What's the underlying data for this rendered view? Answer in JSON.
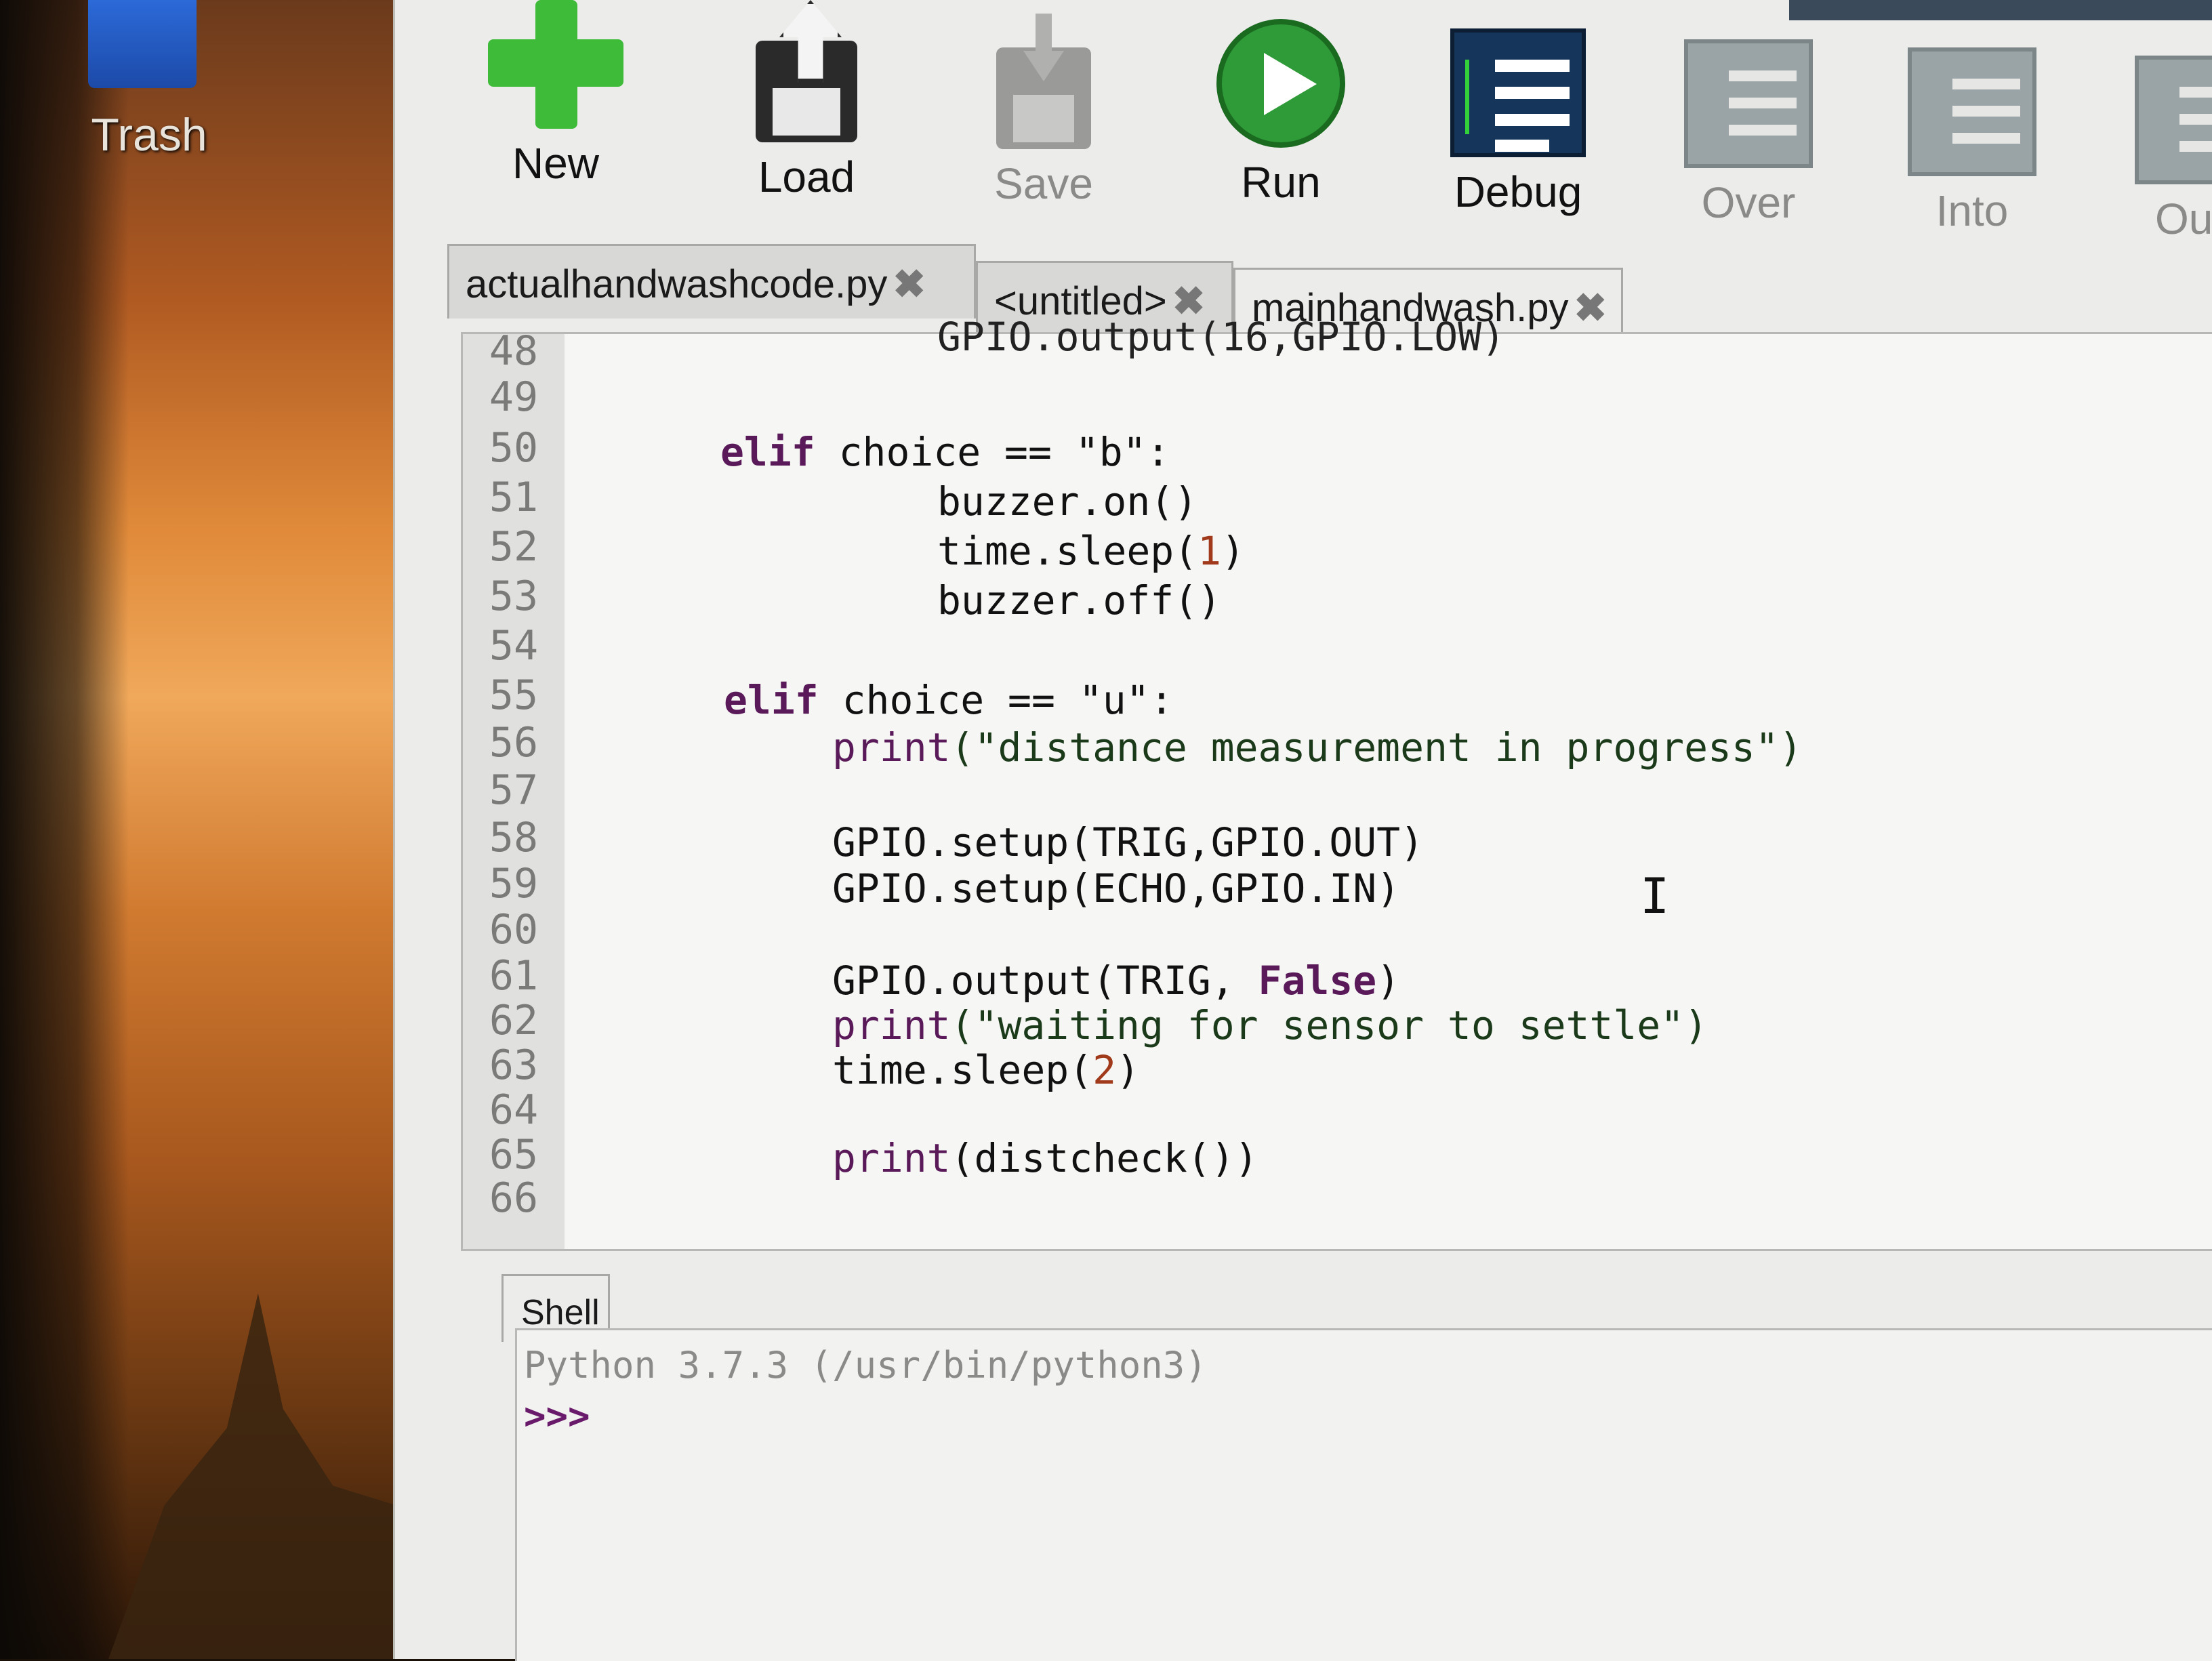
{
  "desktop": {
    "trash_label": "Trash"
  },
  "toolbar": {
    "new_label": "New",
    "load_label": "Load",
    "save_label": "Save",
    "run_label": "Run",
    "debug_label": "Debug",
    "over_label": "Over",
    "into_label": "Into",
    "out_label": "Out"
  },
  "tabs": [
    {
      "label": "actualhandwashcode.py",
      "close": "✖"
    },
    {
      "label": "<untitled>",
      "close": "✖"
    },
    {
      "label": "mainhandwash.py",
      "close": "✖"
    }
  ],
  "editor": {
    "line_numbers": [
      "48",
      "49",
      "50",
      "51",
      "52",
      "53",
      "54",
      "55",
      "56",
      "57",
      "58",
      "59",
      "60",
      "61",
      "62",
      "63",
      "64",
      "65",
      "66"
    ],
    "first_line_partial": "GPIO.output(16,GPIO.LOW)",
    "lines": {
      "l50_kw": "elif",
      "l50_rest": " choice == \"b\":",
      "l51": "buzzer.on()",
      "l52_a": "time.sleep(",
      "l52_num": "1",
      "l52_b": ")",
      "l53": "buzzer.off()",
      "l55_kw": "elif",
      "l55_rest": " choice == \"u\":",
      "l56_fn": "print",
      "l56_str": "(\"distance measurement in progress\")",
      "l58": "GPIO.setup(TRIG,GPIO.OUT)",
      "l59": "GPIO.setup(ECHO,GPIO.IN)",
      "l61_a": "GPIO.output(TRIG, ",
      "l61_kw": "False",
      "l61_b": ")",
      "l62_fn": "print",
      "l62_str": "(\"waiting for sensor to settle\")",
      "l63_a": "time.sleep(",
      "l63_num": "2",
      "l63_b": ")",
      "l65_fn": "print",
      "l65_rest": "(distcheck())"
    }
  },
  "shell": {
    "tab_label": "Shell",
    "banner": "Python 3.7.3 (/usr/bin/python3)",
    "prompt": ">>>"
  },
  "colors": {
    "keyword": "#5a1a5a",
    "number": "#a03a1a",
    "run_green": "#2e9a38",
    "new_green": "#3fbb3a",
    "debug_blue": "#15365a"
  }
}
